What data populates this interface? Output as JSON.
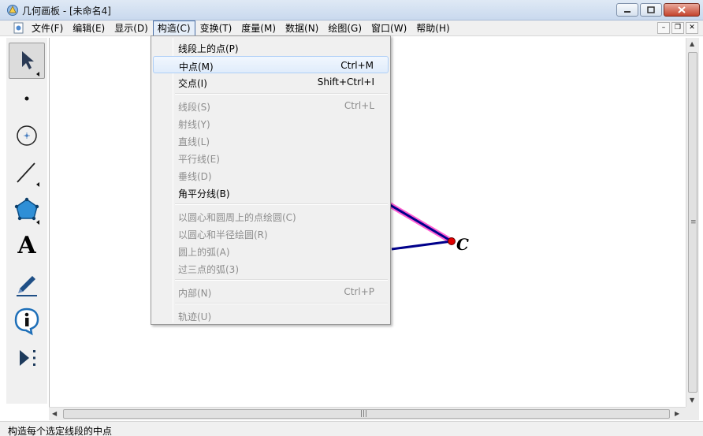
{
  "window": {
    "title": "几何画板 - [未命名4]"
  },
  "menubar": {
    "items": [
      {
        "label": "文件(F)"
      },
      {
        "label": "编辑(E)"
      },
      {
        "label": "显示(D)"
      },
      {
        "label": "构造(C)"
      },
      {
        "label": "变换(T)"
      },
      {
        "label": "度量(M)"
      },
      {
        "label": "数据(N)"
      },
      {
        "label": "绘图(G)"
      },
      {
        "label": "窗口(W)"
      },
      {
        "label": "帮助(H)"
      }
    ],
    "active_index": 3
  },
  "construct_menu": {
    "items": [
      {
        "label": "线段上的点(P)",
        "shortcut": "",
        "enabled": true
      },
      {
        "label": "中点(M)",
        "shortcut": "Ctrl+M",
        "enabled": true,
        "highlighted": true
      },
      {
        "label": "交点(I)",
        "shortcut": "Shift+Ctrl+I",
        "enabled": true
      },
      {
        "label": "线段(S)",
        "shortcut": "Ctrl+L",
        "enabled": false
      },
      {
        "label": "射线(Y)",
        "shortcut": "",
        "enabled": false
      },
      {
        "label": "直线(L)",
        "shortcut": "",
        "enabled": false
      },
      {
        "label": "平行线(E)",
        "shortcut": "",
        "enabled": false
      },
      {
        "label": "垂线(D)",
        "shortcut": "",
        "enabled": false
      },
      {
        "label": "角平分线(B)",
        "shortcut": "",
        "enabled": true
      },
      {
        "label": "以圆心和圆周上的点绘圆(C)",
        "shortcut": "",
        "enabled": false
      },
      {
        "label": "以圆心和半径绘圆(R)",
        "shortcut": "",
        "enabled": false
      },
      {
        "label": "圆上的弧(A)",
        "shortcut": "",
        "enabled": false
      },
      {
        "label": "过三点的弧(3)",
        "shortcut": "",
        "enabled": false
      },
      {
        "label": "内部(N)",
        "shortcut": "Ctrl+P",
        "enabled": false
      },
      {
        "label": "轨迹(U)",
        "shortcut": "",
        "enabled": false
      }
    ]
  },
  "toolbox": {
    "tools": [
      {
        "icon": "arrow-select-icon",
        "selected": true
      },
      {
        "icon": "point-tool-icon"
      },
      {
        "icon": "compass-tool-icon"
      },
      {
        "icon": "straightedge-tool-icon"
      },
      {
        "icon": "polygon-tool-icon"
      },
      {
        "icon": "text-tool-icon",
        "glyph": "A"
      },
      {
        "icon": "marker-tool-icon"
      },
      {
        "icon": "information-tool-icon"
      },
      {
        "icon": "custom-tool-icon"
      }
    ]
  },
  "sketch": {
    "point_label": "C",
    "colors": {
      "segment": "#00008b",
      "selection": "#ff5fd2",
      "point": "#e00000"
    }
  },
  "hscroll": {
    "grip": "|||"
  },
  "vscroll": {
    "grip": "≡"
  },
  "status": {
    "text": "构造每个选定线段的中点"
  }
}
